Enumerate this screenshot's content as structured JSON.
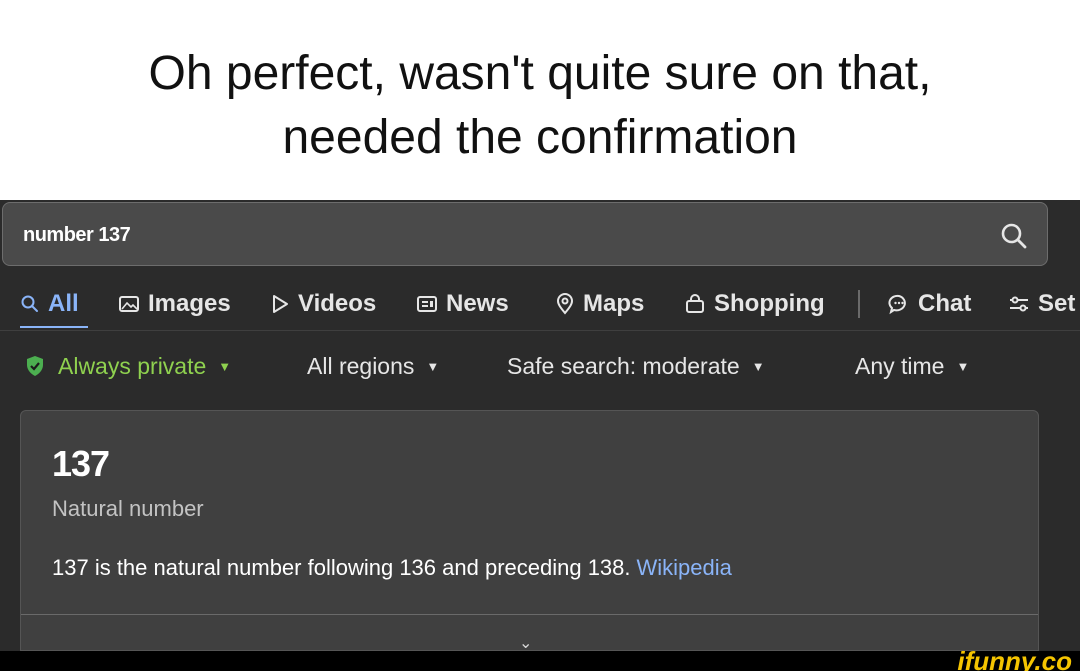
{
  "caption": {
    "line1": "Oh perfect, wasn't quite sure on that,",
    "line2": "needed the confirmation"
  },
  "search": {
    "query": "number 137",
    "icon": "search-icon"
  },
  "tabs": [
    {
      "label": "All",
      "icon": "search-icon",
      "active": true
    },
    {
      "label": "Images",
      "icon": "image-icon"
    },
    {
      "label": "Videos",
      "icon": "play-icon"
    },
    {
      "label": "News",
      "icon": "newspaper-icon"
    },
    {
      "label": "Maps",
      "icon": "map-pin-icon"
    },
    {
      "label": "Shopping",
      "icon": "shopping-bag-icon"
    },
    {
      "label": "Chat",
      "icon": "chat-icon"
    },
    {
      "label": "Set",
      "icon": "settings-sliders-icon"
    }
  ],
  "filters": {
    "privacy": "Always private",
    "region": "All regions",
    "safe_search": "Safe search: moderate",
    "time": "Any time"
  },
  "card": {
    "title": "137",
    "subtitle": "Natural number",
    "description": "137 is the natural number following 136 and preceding 138.",
    "source_link": "Wikipedia"
  },
  "watermark": "ifunny.co",
  "colors": {
    "accent": "#8ab4f8",
    "private_green": "#8fd14f",
    "watermark": "#f5c400",
    "background": "#2b2b2b"
  }
}
